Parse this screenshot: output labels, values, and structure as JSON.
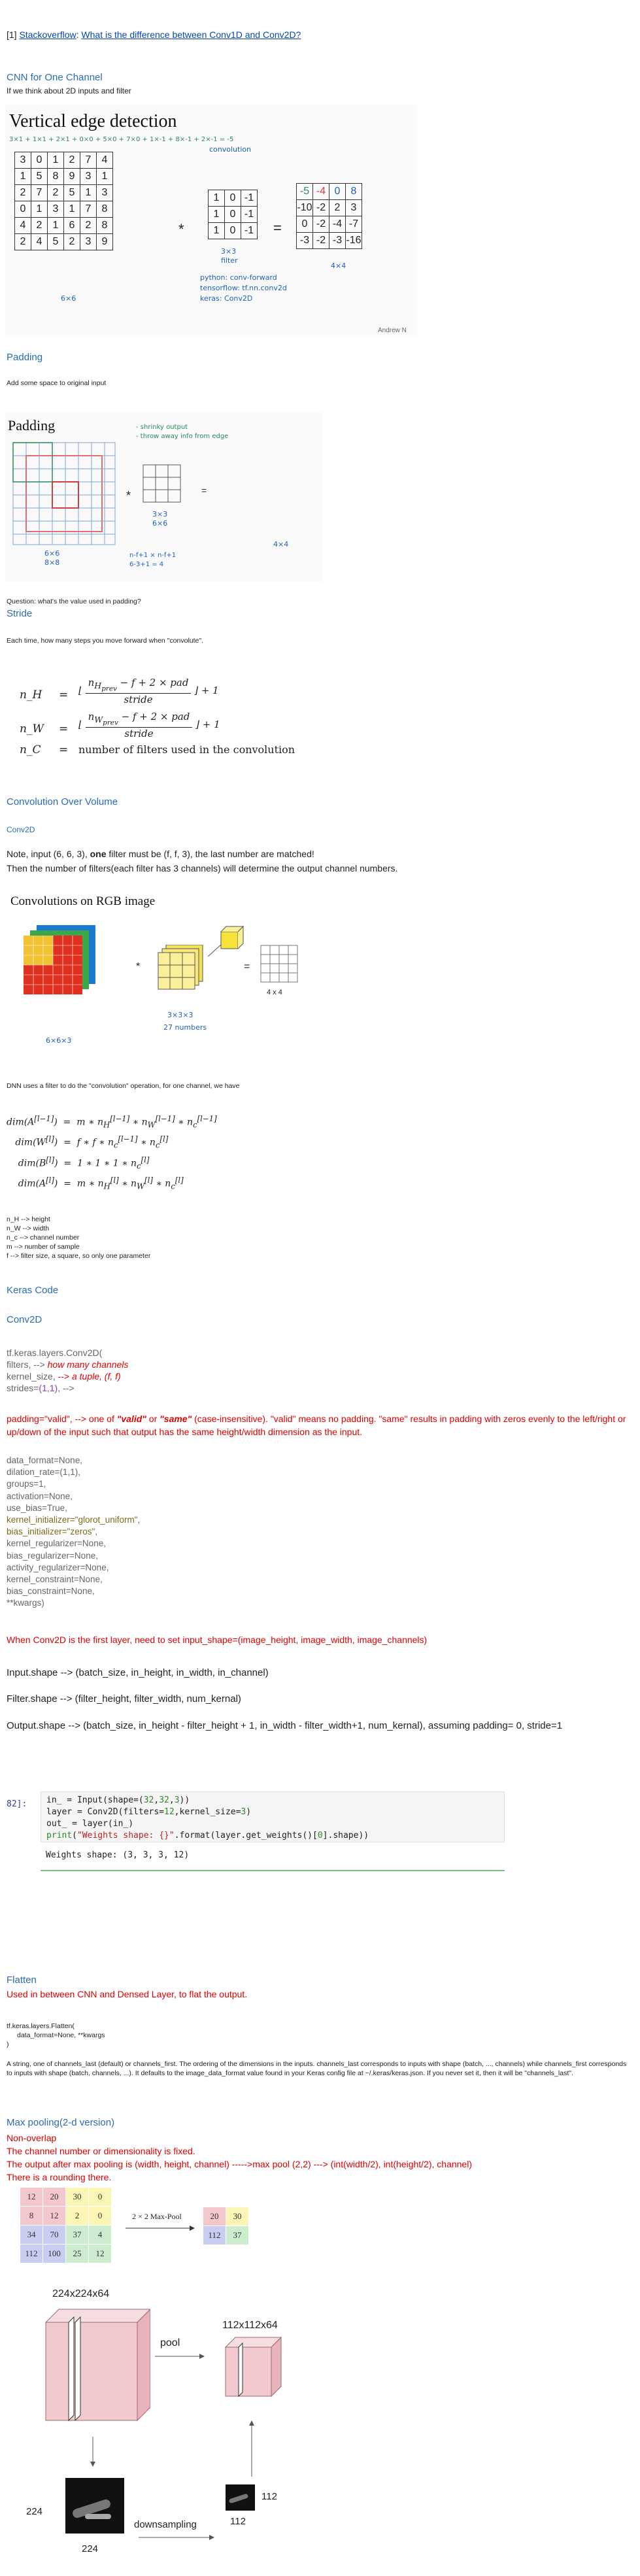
{
  "header": {
    "prefix": "[1]",
    "link1": "Stackoverflow",
    "sep": ":",
    "link2": "What is the difference between Conv1D and Conv2D?"
  },
  "cnn": {
    "title": "CNN for One Channel",
    "subtitle": "If we think about 2D inputs and filter"
  },
  "vedge": {
    "title": "Vertical edge detection",
    "top_formula": "3×1 + 1×1 + 2×1 + 0×0 + 5×0 + 7×0 + 1×-1 + 8×-1 + 2×-1 = -5",
    "input": [
      [
        3,
        0,
        1,
        2,
        7,
        4
      ],
      [
        1,
        5,
        8,
        9,
        3,
        1
      ],
      [
        2,
        7,
        2,
        5,
        1,
        3
      ],
      [
        0,
        1,
        3,
        1,
        7,
        8
      ],
      [
        4,
        2,
        1,
        6,
        2,
        8
      ],
      [
        2,
        4,
        5,
        2,
        3,
        9
      ]
    ],
    "filter": [
      [
        1,
        0,
        -1
      ],
      [
        1,
        0,
        -1
      ],
      [
        1,
        0,
        -1
      ]
    ],
    "output": [
      [
        -5,
        -4,
        0,
        8
      ],
      [
        -10,
        -2,
        2,
        3
      ],
      [
        0,
        -2,
        -4,
        -7
      ],
      [
        -3,
        -2,
        -3,
        -16
      ]
    ],
    "conv_note": "convolution",
    "input_size": "6×6",
    "filter_size": "3×3",
    "filter_word": "filter",
    "output_size": "4×4",
    "python_note": "python: conv-forward",
    "tf_note": "tensorflow: tf.nn.conv2d",
    "keras_note": "keras: Conv2D",
    "credit": "Andrew N"
  },
  "padding": {
    "heading": "Padding",
    "desc": "Add some space to original input",
    "img_title": "Padding",
    "note1": "- shrinky output",
    "note2": "- throw away info from edge",
    "in_size_a": "6×6",
    "in_size_b": "8×8",
    "filt_size_a": "3×3",
    "filt_size_b": "6×6",
    "formula_a": "n-f+1 × n-f+1",
    "formula_b": "6-3+1 = 4",
    "out_size": "4×4",
    "question": "Question: what's the value used in padding?"
  },
  "stride": {
    "heading": "Stride",
    "desc": "Each time, how many steps you move forward when \"convolute\".",
    "nh_lhs": "n_H",
    "nw_lhs": "n_W",
    "nc_lhs": "n_C",
    "nc_rhs": "number of filters used in the convolution"
  },
  "conv_volume": {
    "heading": "Convolution Over Volume",
    "sub": "Conv2D",
    "note_pre": "Note, input (6, 6, 3), ",
    "note_bold": "one",
    "note_post": " filter must be (f, f, 3), the last number are matched!",
    "note2": "Then the number of filters(each filter has 3 channels) will determine the output channel numbers.",
    "img_title": "Convolutions on RGB image",
    "in_label": "6×6×3",
    "filt_label": "3×3×3",
    "filt_note": "27 numbers",
    "out_label": "4 x 4"
  },
  "dnn": {
    "text": "DNN uses a filter to do the \"convolution\" operation, for one channel, we have"
  },
  "defs": [
    "n_H --> height",
    "n_W --> width",
    "n_c --> channel number",
    "m --> number of sample",
    "f --> filter size, a square, so only one parameter"
  ],
  "keras": {
    "heading": "Keras Code",
    "sub": "Conv2D",
    "line1": "tf.keras.layers.Conv2D(",
    "filters_key": "filters, -->",
    "filters_note": "how many channels",
    "ks_key": "kernel_size,",
    "ks_arrow": "-->",
    "ks_note": "a tuple, (f, f)",
    "strides_key": "strides=",
    "strides_val": "(1,1)",
    "strides_arrow": ", -->",
    "padding_a": "padding=\"valid\", --> one of ",
    "padding_valid": "\"valid\"",
    "padding_or": " or ",
    "padding_same": "\"same\"",
    "padding_rest": " (case-insensitive). \"valid\" means no padding. \"same\" results in padding with zeros evenly to the left/right or up/down of the input such that output has the same height/width dimension as the input.",
    "params": [
      "data_format=None,",
      "dilation_rate=(1,1),",
      "groups=1,",
      "activation=None,",
      "use_bias=True,",
      "kernel_initializer=\"glorot_uniform\",",
      "bias_initializer=\"zeros\",",
      "kernel_regularizer=None,",
      "bias_regularizer=None,",
      "activity_regularizer=None,",
      "kernel_constraint=None,",
      "bias_constraint=None,",
      "**kwargs)"
    ],
    "first_layer_note": "When Conv2D is the first layer, need to set input_shape=(image_height, image_width, image_channels)",
    "input_shape": "Input.shape --> (batch_size, in_height, in_width, in_channel)",
    "filter_shape": "Filter.shape --> (filter_height, filter_width, num_kernal)",
    "output_shape": "Output.shape --> (batch_size, in_height - filter_height + 1, in_width - filter_width+1, num_kernal), assuming padding= 0, stride=1"
  },
  "code": {
    "prompt": "82]:",
    "lines": [
      "in_ = Input(shape=(32,32,3))",
      "layer = Conv2D(filters=12,kernel_size=3)",
      "out_ = layer(in_)",
      "print(\"Weights shape: {}\".format(layer.get_weights()[0].shape))"
    ],
    "output": "Weights shape: (3, 3, 3, 12)"
  },
  "flatten": {
    "heading": "Flatten",
    "sub": "Used in between CNN and Densed Layer, to flat the output.",
    "code1": "tf.keras.layers.Flatten(",
    "code2": "data_format=None, **kwargs",
    "code3": ")",
    "desc": "A string, one of channels_last (default) or channels_first. The ordering of the dimensions in the inputs. channels_last corresponds to inputs with shape (batch, ..., channels) while channels_first corresponds to inputs with shape (batch, channels, ...). It defaults to the image_data_format value found in your Keras config file at ~/.keras/keras.json. If you never set it, then it will be \"channels_last\"."
  },
  "maxpool": {
    "heading": "Max pooling(2-d version)",
    "l1": "Non-overlap",
    "l2": "The channel number or dimensionality is fixed.",
    "l3": "The output after max pooling is (width, height, channel) ----->max pool (2,2) ---> (int(width/2), int(height/2), channel)",
    "l4": "There is a rounding there.",
    "grid": [
      [
        12,
        20,
        30,
        0
      ],
      [
        8,
        12,
        2,
        0
      ],
      [
        34,
        70,
        37,
        4
      ],
      [
        112,
        100,
        25,
        12
      ]
    ],
    "op_label": "2 × 2 Max-Pool",
    "out": [
      [
        20,
        30
      ],
      [
        112,
        37
      ]
    ],
    "top_label": "224x224x64",
    "pool_label": "pool",
    "right_label": "112x112x64",
    "down_label": "downsampling",
    "dim224a": "224",
    "dim224b": "224",
    "dim112a": "112",
    "dim112b": "112"
  },
  "colors": {
    "link": "#0645ad",
    "heading_blue": "#2a6ab8",
    "red": "#e00000",
    "purple": "#8a3ab9",
    "pool_pink": "#f2c9cf",
    "mp_pink": "#f4c7cf",
    "mp_yellow": "#fbf5b5",
    "mp_blue": "#c9cdf2",
    "mp_green": "#cdeccd"
  }
}
